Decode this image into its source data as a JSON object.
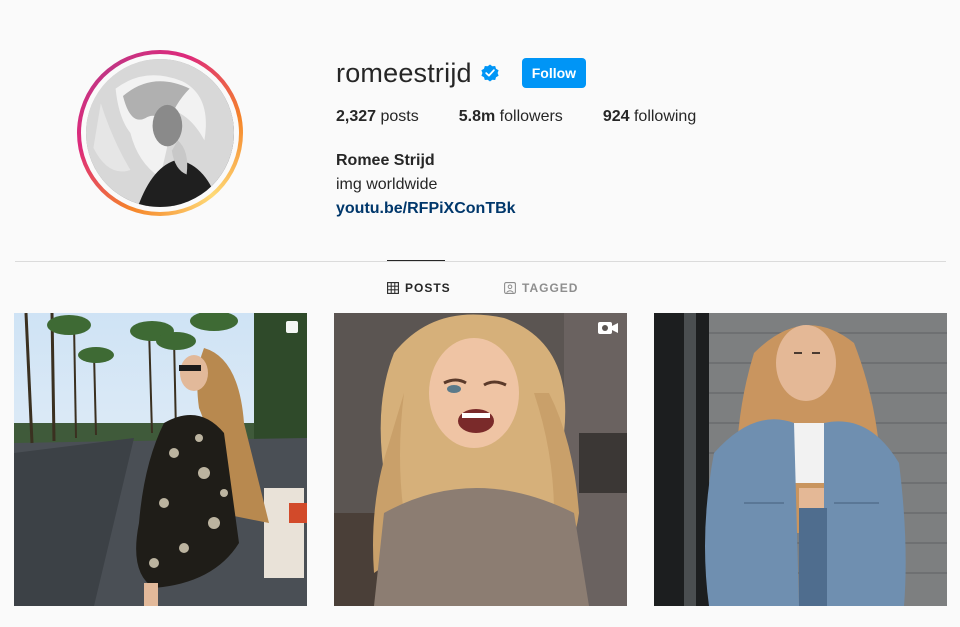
{
  "profile": {
    "username": "romeestrijd",
    "verified": true,
    "follow_label": "Follow",
    "stats": {
      "posts_count": "2,327",
      "posts_label": "posts",
      "followers_count": "5.8m",
      "followers_label": "followers",
      "following_count": "924",
      "following_label": "following"
    },
    "full_name": "Romee Strijd",
    "bio_line": "img worldwide",
    "link": "youtu.be/RFPiXConTBk"
  },
  "tabs": [
    {
      "label": "POSTS",
      "icon": "grid-icon",
      "active": true
    },
    {
      "label": "TAGGED",
      "icon": "tagged-icon",
      "active": false
    }
  ],
  "posts": [
    {
      "type": "carousel",
      "badge_icon": "carousel-icon",
      "scene": "street-palm-trees"
    },
    {
      "type": "video",
      "badge_icon": "video-icon",
      "scene": "blonde-smiling-wink"
    },
    {
      "type": "photo",
      "badge_icon": "",
      "scene": "denim-jacket-brick-wall"
    }
  ],
  "colors": {
    "accent": "#0095f6",
    "link": "#00376b",
    "text": "#262626",
    "muted": "#8e8e8e",
    "background": "#fafafa"
  }
}
